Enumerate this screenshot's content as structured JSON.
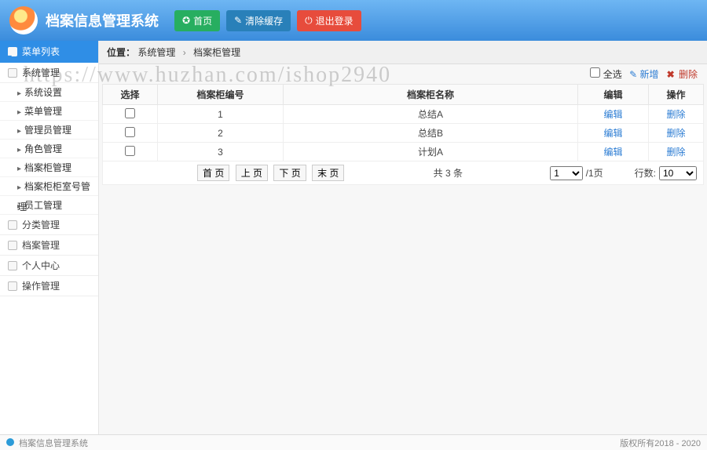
{
  "header": {
    "app_title": "档案信息管理系统",
    "home_label": "首页",
    "clear_cache_label": "清除缓存",
    "logout_label": "退出登录"
  },
  "sidebar": {
    "title": "菜单列表",
    "group1": {
      "label": "系统管理",
      "items": [
        "系统设置",
        "菜单管理",
        "管理员管理",
        "角色管理",
        "档案柜管理",
        "档案柜柜室号管理",
        "员工管理"
      ]
    },
    "others": [
      "分类管理",
      "档案管理",
      "个人中心",
      "操作管理"
    ]
  },
  "crumb": {
    "prefix": "位置：",
    "a": "系统管理",
    "b": "档案柜管理"
  },
  "toolbar": {
    "select_all": "全选",
    "add": "新增",
    "delete": "删除"
  },
  "table": {
    "cols": {
      "select": "选择",
      "num": "档案柜编号",
      "name": "档案柜名称",
      "edit": "编辑",
      "op": "操作"
    },
    "rows": [
      {
        "num": "1",
        "name": "总结A",
        "edit": "编辑",
        "del": "删除"
      },
      {
        "num": "2",
        "name": "总结B",
        "edit": "编辑",
        "del": "删除"
      },
      {
        "num": "3",
        "name": "计划A",
        "edit": "编辑",
        "del": "删除"
      }
    ]
  },
  "pager": {
    "first": "首 页",
    "prev": "上 页",
    "next": "下 页",
    "last": "末 页",
    "total": "共 3 条",
    "page_of": "/1页",
    "page_current": "1",
    "rows_label": "行数:",
    "rows_value": "10"
  },
  "footer": {
    "left": "档案信息管理系统",
    "right": "版权所有2018 - 2020"
  },
  "watermark": "https://www.huzhan.com/ishop2940"
}
